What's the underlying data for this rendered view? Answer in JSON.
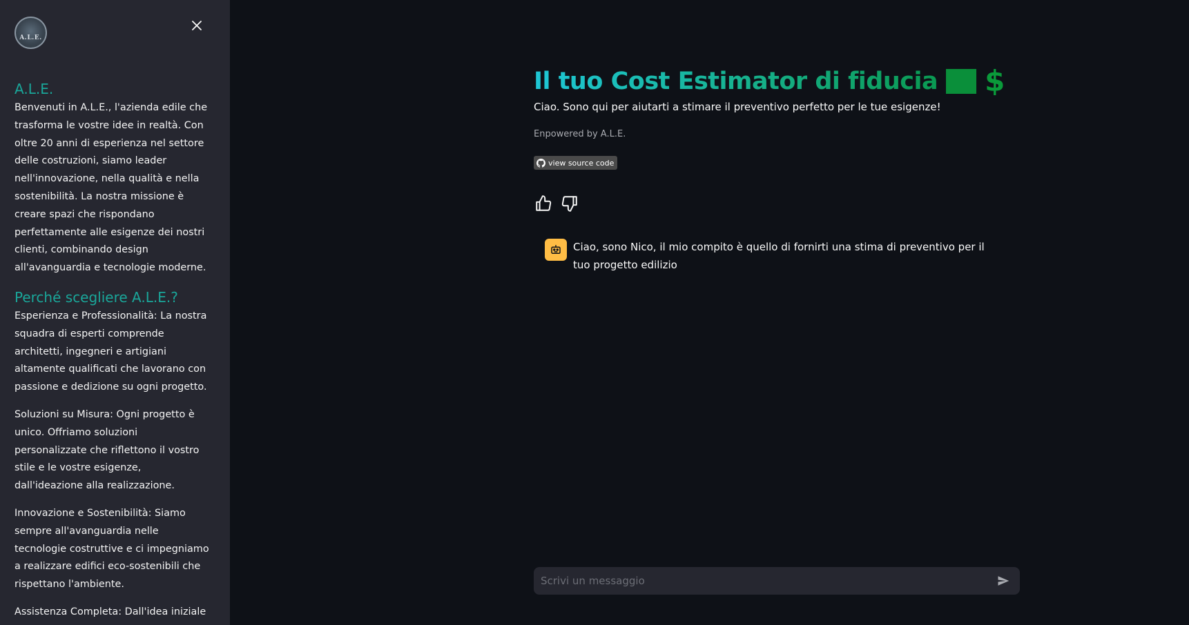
{
  "sidebar": {
    "logo_text": "A.L.E.",
    "heading1": "A.L.E.",
    "intro": "Benvenuti in A.L.E., l'azienda edile che trasforma le vostre idee in realtà. Con oltre 20 anni di esperienza nel settore delle costruzioni, siamo leader nell'innovazione, nella qualità e nella sostenibilità. La nostra missione è creare spazi che rispondano perfettamente alle esigenze dei nostri clienti, combinando design all'avanguardia e tecnologie moderne.",
    "heading2": "Perché scegliere A.L.E.?",
    "points": [
      "Esperienza e Professionalità: La nostra squadra di esperti comprende architetti, ingegneri e artigiani altamente qualificati che lavorano con passione e dedizione su ogni progetto.",
      "Soluzioni su Misura: Ogni progetto è unico. Offriamo soluzioni personalizzate che riflettono il vostro stile e le vostre esigenze, dall'ideazione alla realizzazione.",
      "Innovazione e Sostenibilità: Siamo sempre all'avanguardia nelle tecnologie costruttive e ci impegniamo a realizzare edifici eco-sostenibili che rispettano l'ambiente.",
      "Assistenza Completa: Dall'idea iniziale alla consegna chiavi in mano, vi"
    ]
  },
  "main": {
    "title": "Il tuo Cost Estimator di fiducia",
    "title_emoji": "$",
    "subtitle": "Ciao. Sono qui per aiutarti a stimare il preventivo perfetto per le tue esigenze!",
    "powered": "Enpowered by A.L.E.",
    "badge_label": "view source code"
  },
  "chat": {
    "messages": [
      {
        "role": "assistant",
        "text": "Ciao, sono Nico, il mio compito è quello di fornirti una stima di preventivo per il tuo progetto edilizio"
      }
    ],
    "input_placeholder": "Scrivi un messaggio"
  },
  "colors": {
    "sidebar_bg": "#262730",
    "main_bg": "#0e1117",
    "accent_teal": "#1aa79a",
    "avatar": "#ffbd45"
  }
}
